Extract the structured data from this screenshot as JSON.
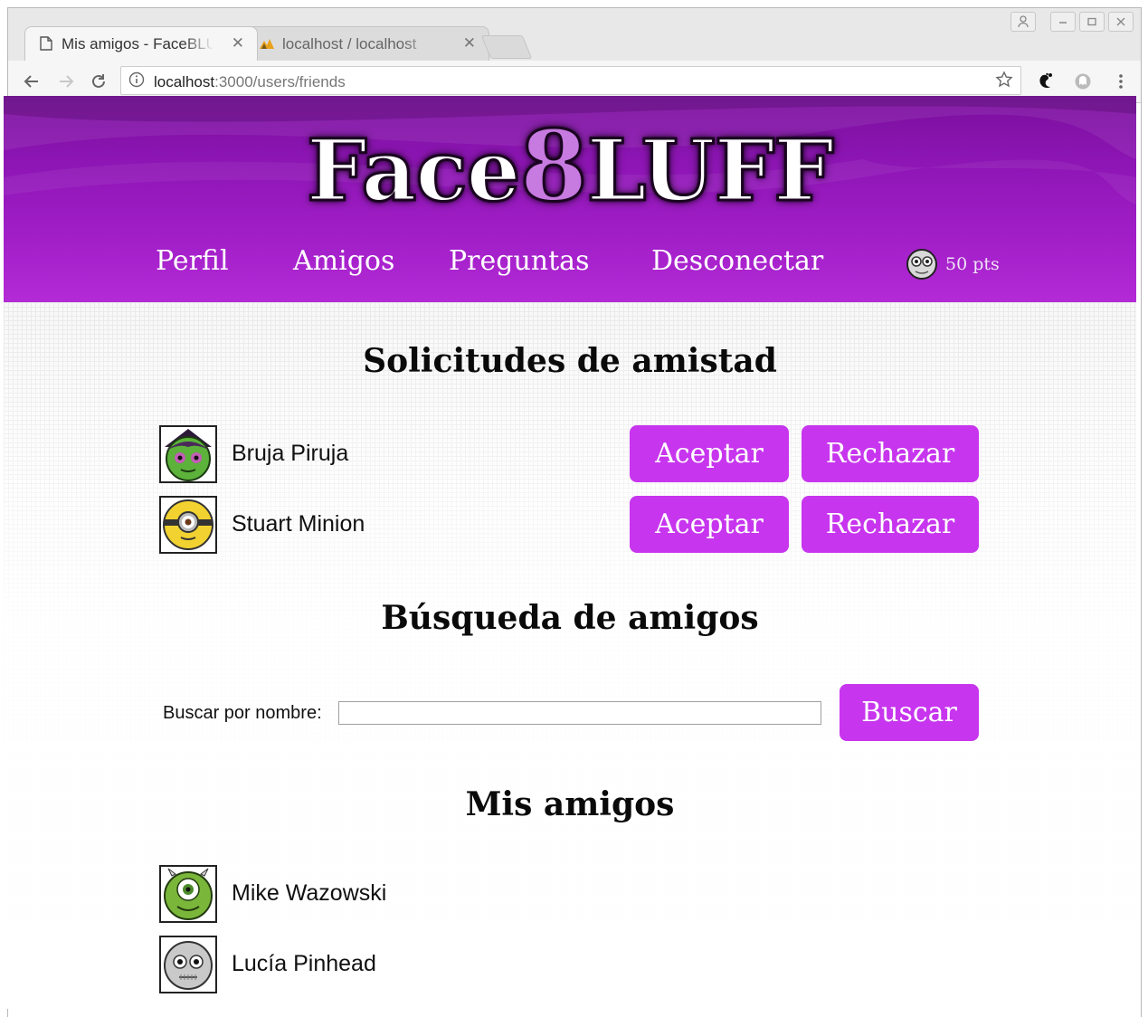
{
  "browser": {
    "tabs": [
      {
        "title": "Mis amigos - FaceBLUFF",
        "active": true,
        "icon": "page-icon"
      },
      {
        "title": "localhost / localhost",
        "active": false,
        "icon": "phpmyadmin-icon"
      }
    ],
    "url": {
      "host": "localhost",
      "rest": ":3000/users/friends"
    }
  },
  "site": {
    "logo": {
      "part1": "Face",
      "part2": "8",
      "part3": "LUFF"
    },
    "nav": [
      {
        "label": "Perfil"
      },
      {
        "label": "Amigos"
      },
      {
        "label": "Preguntas"
      },
      {
        "label": "Desconectar"
      }
    ],
    "points": "50 pts"
  },
  "requests": {
    "title": "Solicitudes de amistad",
    "items": [
      {
        "name": "Bruja Piruja",
        "avatar": "witch-avatar-icon",
        "accept": "Aceptar",
        "reject": "Rechazar"
      },
      {
        "name": "Stuart Minion",
        "avatar": "minion-avatar-icon",
        "accept": "Aceptar",
        "reject": "Rechazar"
      }
    ]
  },
  "search": {
    "title": "Búsqueda de amigos",
    "label": "Buscar por nombre:",
    "value": "",
    "button": "Buscar"
  },
  "friends": {
    "title": "Mis amigos",
    "items": [
      {
        "name": "Mike Wazowski",
        "avatar": "mike-avatar-icon"
      },
      {
        "name": "Lucía Pinhead",
        "avatar": "pinhead-avatar-icon"
      }
    ]
  },
  "colors": {
    "primary": "#c735ee",
    "header": "#9a1cc0",
    "logo_accent": "#c77ae0"
  }
}
